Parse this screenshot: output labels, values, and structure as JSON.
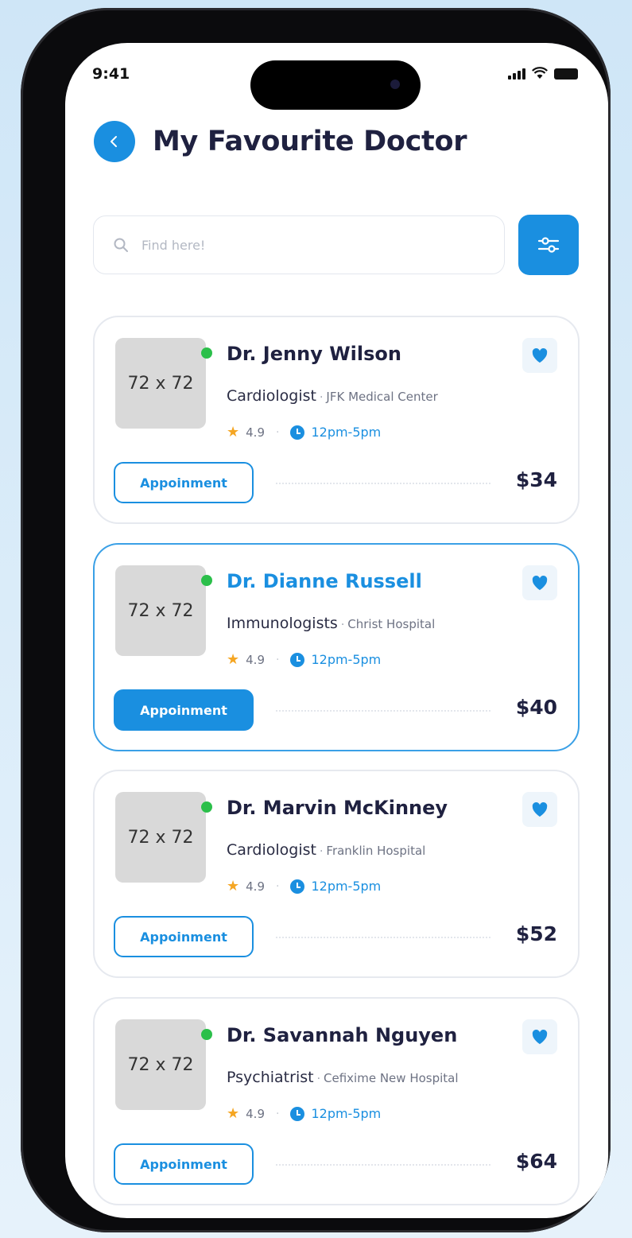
{
  "status_bar": {
    "time": "9:41"
  },
  "header": {
    "title": "My Favourite Doctor"
  },
  "search": {
    "placeholder": "Find here!"
  },
  "colors": {
    "accent": "#1a8fe0",
    "online": "#2bbf4a",
    "star": "#f5a623"
  },
  "doctors": [
    {
      "avatar": "72 x 72",
      "name": "Dr. Jenny Wilson",
      "specialty": "Cardiologist",
      "hospital": "JFK Medical Center",
      "rating": "4.9",
      "hours": "12pm-5pm",
      "button": "Appoinment",
      "price": "$34"
    },
    {
      "avatar": "72 x 72",
      "name": "Dr. Dianne Russell",
      "specialty": "Immunologists",
      "hospital": "Christ Hospital",
      "rating": "4.9",
      "hours": "12pm-5pm",
      "button": "Appoinment",
      "price": "$40"
    },
    {
      "avatar": "72 x 72",
      "name": "Dr. Marvin McKinney",
      "specialty": "Cardiologist",
      "hospital": "Franklin Hospital",
      "rating": "4.9",
      "hours": "12pm-5pm",
      "button": "Appoinment",
      "price": "$52"
    },
    {
      "avatar": "72 x 72",
      "name": "Dr. Savannah Nguyen",
      "specialty": "Psychiatrist",
      "hospital": "Cefixime New Hospital",
      "rating": "4.9",
      "hours": "12pm-5pm",
      "button": "Appoinment",
      "price": "$64"
    }
  ]
}
